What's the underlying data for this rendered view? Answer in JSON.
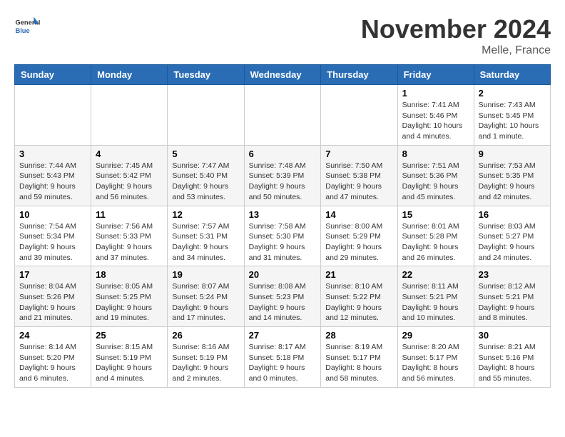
{
  "logo": {
    "text_general": "General",
    "text_blue": "Blue"
  },
  "title": "November 2024",
  "location": "Melle, France",
  "weekdays": [
    "Sunday",
    "Monday",
    "Tuesday",
    "Wednesday",
    "Thursday",
    "Friday",
    "Saturday"
  ],
  "weeks": [
    [
      {
        "day": "",
        "info": ""
      },
      {
        "day": "",
        "info": ""
      },
      {
        "day": "",
        "info": ""
      },
      {
        "day": "",
        "info": ""
      },
      {
        "day": "",
        "info": ""
      },
      {
        "day": "1",
        "info": "Sunrise: 7:41 AM\nSunset: 5:46 PM\nDaylight: 10 hours and 4 minutes."
      },
      {
        "day": "2",
        "info": "Sunrise: 7:43 AM\nSunset: 5:45 PM\nDaylight: 10 hours and 1 minute."
      }
    ],
    [
      {
        "day": "3",
        "info": "Sunrise: 7:44 AM\nSunset: 5:43 PM\nDaylight: 9 hours and 59 minutes."
      },
      {
        "day": "4",
        "info": "Sunrise: 7:45 AM\nSunset: 5:42 PM\nDaylight: 9 hours and 56 minutes."
      },
      {
        "day": "5",
        "info": "Sunrise: 7:47 AM\nSunset: 5:40 PM\nDaylight: 9 hours and 53 minutes."
      },
      {
        "day": "6",
        "info": "Sunrise: 7:48 AM\nSunset: 5:39 PM\nDaylight: 9 hours and 50 minutes."
      },
      {
        "day": "7",
        "info": "Sunrise: 7:50 AM\nSunset: 5:38 PM\nDaylight: 9 hours and 47 minutes."
      },
      {
        "day": "8",
        "info": "Sunrise: 7:51 AM\nSunset: 5:36 PM\nDaylight: 9 hours and 45 minutes."
      },
      {
        "day": "9",
        "info": "Sunrise: 7:53 AM\nSunset: 5:35 PM\nDaylight: 9 hours and 42 minutes."
      }
    ],
    [
      {
        "day": "10",
        "info": "Sunrise: 7:54 AM\nSunset: 5:34 PM\nDaylight: 9 hours and 39 minutes."
      },
      {
        "day": "11",
        "info": "Sunrise: 7:56 AM\nSunset: 5:33 PM\nDaylight: 9 hours and 37 minutes."
      },
      {
        "day": "12",
        "info": "Sunrise: 7:57 AM\nSunset: 5:31 PM\nDaylight: 9 hours and 34 minutes."
      },
      {
        "day": "13",
        "info": "Sunrise: 7:58 AM\nSunset: 5:30 PM\nDaylight: 9 hours and 31 minutes."
      },
      {
        "day": "14",
        "info": "Sunrise: 8:00 AM\nSunset: 5:29 PM\nDaylight: 9 hours and 29 minutes."
      },
      {
        "day": "15",
        "info": "Sunrise: 8:01 AM\nSunset: 5:28 PM\nDaylight: 9 hours and 26 minutes."
      },
      {
        "day": "16",
        "info": "Sunrise: 8:03 AM\nSunset: 5:27 PM\nDaylight: 9 hours and 24 minutes."
      }
    ],
    [
      {
        "day": "17",
        "info": "Sunrise: 8:04 AM\nSunset: 5:26 PM\nDaylight: 9 hours and 21 minutes."
      },
      {
        "day": "18",
        "info": "Sunrise: 8:05 AM\nSunset: 5:25 PM\nDaylight: 9 hours and 19 minutes."
      },
      {
        "day": "19",
        "info": "Sunrise: 8:07 AM\nSunset: 5:24 PM\nDaylight: 9 hours and 17 minutes."
      },
      {
        "day": "20",
        "info": "Sunrise: 8:08 AM\nSunset: 5:23 PM\nDaylight: 9 hours and 14 minutes."
      },
      {
        "day": "21",
        "info": "Sunrise: 8:10 AM\nSunset: 5:22 PM\nDaylight: 9 hours and 12 minutes."
      },
      {
        "day": "22",
        "info": "Sunrise: 8:11 AM\nSunset: 5:21 PM\nDaylight: 9 hours and 10 minutes."
      },
      {
        "day": "23",
        "info": "Sunrise: 8:12 AM\nSunset: 5:21 PM\nDaylight: 9 hours and 8 minutes."
      }
    ],
    [
      {
        "day": "24",
        "info": "Sunrise: 8:14 AM\nSunset: 5:20 PM\nDaylight: 9 hours and 6 minutes."
      },
      {
        "day": "25",
        "info": "Sunrise: 8:15 AM\nSunset: 5:19 PM\nDaylight: 9 hours and 4 minutes."
      },
      {
        "day": "26",
        "info": "Sunrise: 8:16 AM\nSunset: 5:19 PM\nDaylight: 9 hours and 2 minutes."
      },
      {
        "day": "27",
        "info": "Sunrise: 8:17 AM\nSunset: 5:18 PM\nDaylight: 9 hours and 0 minutes."
      },
      {
        "day": "28",
        "info": "Sunrise: 8:19 AM\nSunset: 5:17 PM\nDaylight: 8 hours and 58 minutes."
      },
      {
        "day": "29",
        "info": "Sunrise: 8:20 AM\nSunset: 5:17 PM\nDaylight: 8 hours and 56 minutes."
      },
      {
        "day": "30",
        "info": "Sunrise: 8:21 AM\nSunset: 5:16 PM\nDaylight: 8 hours and 55 minutes."
      }
    ]
  ]
}
